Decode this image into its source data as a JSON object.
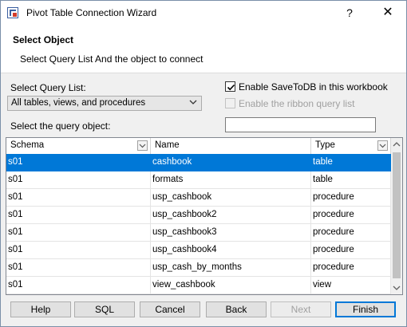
{
  "window": {
    "title": "Pivot Table Connection Wizard",
    "help_glyph": "?",
    "close_glyph": "✕"
  },
  "header": {
    "title": "Select Object",
    "subtitle": "Select Query List And the object to connect"
  },
  "query_list": {
    "label": "Select Query List:",
    "selected": "All tables, views, and procedures"
  },
  "options": {
    "enable_savetodb": {
      "label": "Enable SaveToDB in this workbook",
      "checked": true
    },
    "enable_ribbon": {
      "label": "Enable the ribbon query list",
      "checked": false,
      "disabled": true
    }
  },
  "query_object": {
    "label": "Select the query object:",
    "value": ""
  },
  "grid": {
    "columns": [
      "Schema",
      "Name",
      "Type"
    ],
    "rows": [
      [
        "s01",
        "cashbook",
        "table"
      ],
      [
        "s01",
        "formats",
        "table"
      ],
      [
        "s01",
        "usp_cashbook",
        "procedure"
      ],
      [
        "s01",
        "usp_cashbook2",
        "procedure"
      ],
      [
        "s01",
        "usp_cashbook3",
        "procedure"
      ],
      [
        "s01",
        "usp_cashbook4",
        "procedure"
      ],
      [
        "s01",
        "usp_cash_by_months",
        "procedure"
      ],
      [
        "s01",
        "view_cashbook",
        "view"
      ]
    ],
    "selected_index": 0
  },
  "buttons": {
    "help": "Help",
    "sql": "SQL",
    "cancel": "Cancel",
    "back": "Back",
    "next": "Next",
    "finish": "Finish"
  },
  "colors": {
    "selection": "#0078d7",
    "primary_border": "#0078d7"
  }
}
